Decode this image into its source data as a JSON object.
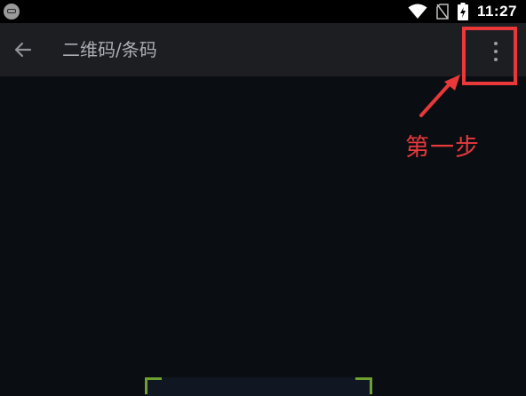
{
  "status_bar": {
    "time": "11:27",
    "icons": [
      "app-notification-icon",
      "wifi-icon",
      "no-sim-icon",
      "battery-charging-icon"
    ]
  },
  "app_bar": {
    "title": "二维码/条码",
    "back_icon": "back-arrow-icon",
    "menu_icon": "more-vert-icon"
  },
  "annotation": {
    "label": "第一步",
    "color": "#e8383a"
  },
  "scanner": {
    "corner_color": "#6fa12f"
  },
  "colors": {
    "background": "#0a0d12",
    "app_bar": "#1c1e22",
    "title_text": "#a9acb2"
  }
}
